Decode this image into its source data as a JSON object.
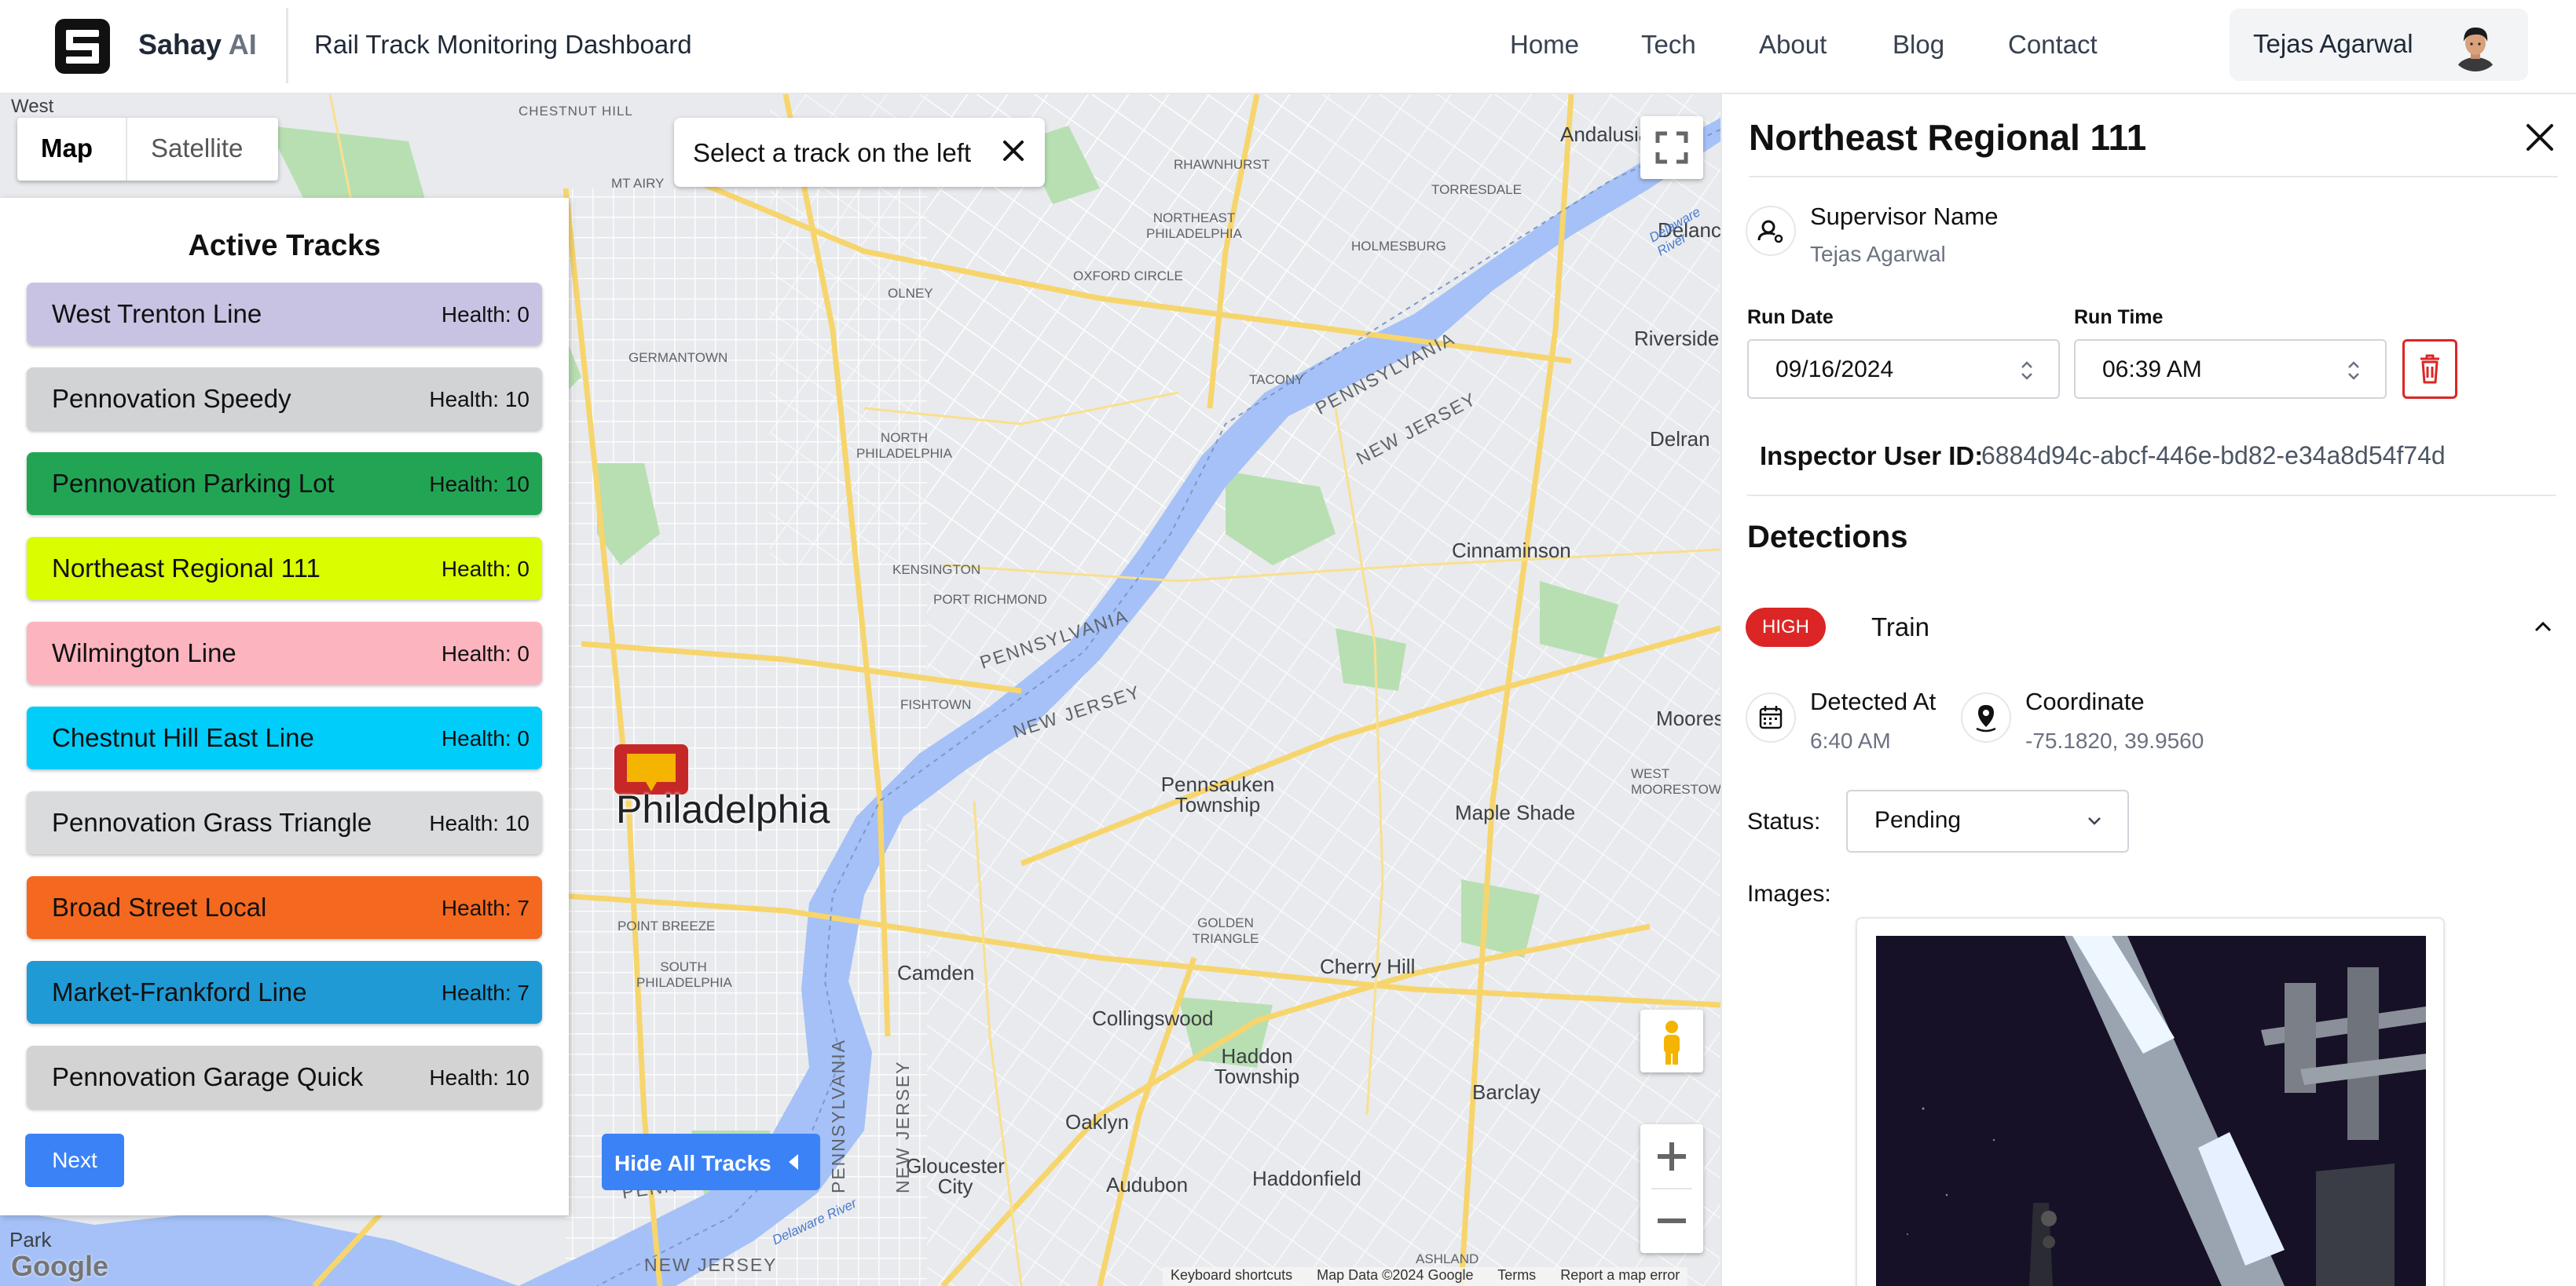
{
  "header": {
    "brand_name": "Sahay",
    "brand_suffix": "AI",
    "app_title": "Rail Track Monitoring Dashboard",
    "nav": [
      "Home",
      "Tech",
      "About",
      "Blog",
      "Contact"
    ],
    "user_name": "Tejas Agarwal"
  },
  "map": {
    "type_toggle": [
      "Map",
      "Satellite"
    ],
    "selected_type": "Map",
    "select_message": "Select a track on the left",
    "city_label": "Philadelphia",
    "hide_tracks_label": "Hide All Tracks",
    "google_label": "Google",
    "footer_links": [
      "Keyboard shortcuts",
      "Map Data ©2024 Google",
      "Terms",
      "Report a map error"
    ],
    "place_labels": [
      "Chestnut Hill",
      "West",
      "Mt Airy",
      "Rhawnhurst",
      "Torresdale",
      "Andalusia",
      "Delanco",
      "Northeast Philadelphia",
      "Oxford Circle",
      "Olney",
      "Holmesburg",
      "Riverside",
      "Germantown",
      "Tacony",
      "Pennsylvania",
      "New Jersey",
      "Delran",
      "North Philadelphia",
      "Cinnaminson",
      "Kensington",
      "Port Richmond",
      "Pennsylvania",
      "Fishtown",
      "New Jersey",
      "Moorestown",
      "West Moorestown",
      "Pennsauken Township",
      "Maple Shade",
      "Point Breeze",
      "South Philadelphia",
      "Camden",
      "Golden Triangle",
      "Cherry Hill",
      "Collingswood",
      "Haddon Township",
      "Barclay",
      "Oaklyn",
      "Gloucester City",
      "Audubon",
      "Haddonfield",
      "Pennsylvania",
      "New Jersey",
      "Ashland",
      "Park",
      "Delaware River",
      "Delaware River"
    ]
  },
  "tracks": {
    "title": "Active Tracks",
    "health_prefix": "Health:",
    "items": [
      {
        "name": "West Trenton Line",
        "health": "Health: 0",
        "color": "#c8c3e3"
      },
      {
        "name": "Pennovation Speedy",
        "health": "Health: 10",
        "color": "#d2d3d5"
      },
      {
        "name": "Pennovation Parking Lot",
        "health": "Health: 10",
        "color": "#21a555"
      },
      {
        "name": "Northeast Regional 111",
        "health": "Health: 0",
        "color": "#dafd00"
      },
      {
        "name": "Wilmington Line",
        "health": "Health: 0",
        "color": "#fcb4bf"
      },
      {
        "name": "Chestnut Hill East Line",
        "health": "Health: 0",
        "color": "#00cdf9"
      },
      {
        "name": "Pennovation Grass Triangle",
        "health": "Health: 10",
        "color": "#d9dbdd"
      },
      {
        "name": "Broad Street Local",
        "health": "Health: 7",
        "color": "#f4691f"
      },
      {
        "name": "Market-Frankford Line",
        "health": "Health: 7",
        "color": "#1f9ad5"
      },
      {
        "name": "Pennovation Garage Quick",
        "health": "Health: 10",
        "color": "#d3d3d3"
      }
    ],
    "next_label": "Next"
  },
  "details": {
    "title": "Northeast Regional 111",
    "supervisor_label": "Supervisor Name",
    "supervisor_value": "Tejas Agarwal",
    "run_date_label": "Run Date",
    "run_date_value": "09/16/2024",
    "run_time_label": "Run Time",
    "run_time_value": "06:39 AM",
    "inspector_label": "Inspector User ID:",
    "inspector_value": "6884d94c-abcf-446e-bd82-e34a8d54f74d",
    "detections_title": "Detections",
    "detection": {
      "severity": "HIGH",
      "type": "Train",
      "detected_at_label": "Detected At",
      "detected_at_value": "6:40 AM",
      "coordinate_label": "Coordinate",
      "coordinate_value": "-75.1820, 39.9560",
      "status_label": "Status:",
      "status_value": "Pending",
      "images_label": "Images:"
    }
  },
  "colors": {
    "accent_blue": "#3b82f6",
    "danger_red": "#dc2626",
    "map_water": "#a5c1f7",
    "map_road": "#f7d56d",
    "map_park": "#b8dfb2"
  }
}
